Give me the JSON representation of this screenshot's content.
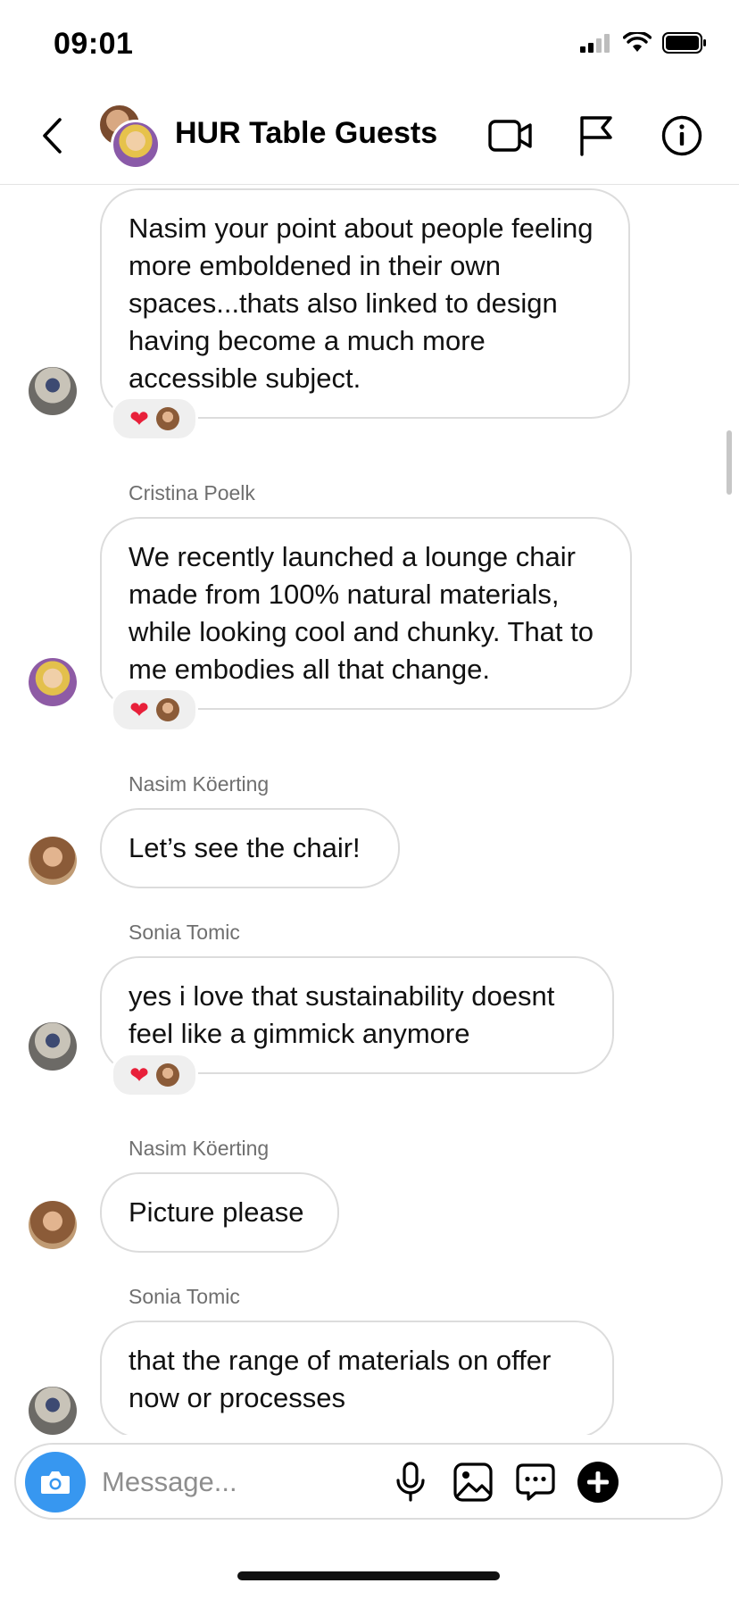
{
  "status_bar": {
    "time": "09:01"
  },
  "header": {
    "title": "HUR Table Guests"
  },
  "messages": [
    {
      "sender": "",
      "text": "Nasim your point about people feeling more emboldened in their own spaces...thats also linked to design having become a much more accessible subject.",
      "avatar": "sonia",
      "reaction": "heart"
    },
    {
      "sender": "Cristina Poelk",
      "text": "We recently launched a lounge chair made from 100% natural materials, while looking cool and chunky. That to me embodies all that change.",
      "avatar": "cristina",
      "reaction": "heart"
    },
    {
      "sender": "Nasim Köerting",
      "text": "Let’s see the chair!",
      "avatar": "nasim",
      "reaction": null
    },
    {
      "sender": "Sonia Tomic",
      "text": "yes i love that sustainability doesnt feel like a gimmick anymore",
      "avatar": "sonia",
      "reaction": "heart"
    },
    {
      "sender": "Nasim Köerting",
      "text": "Picture please",
      "avatar": "nasim",
      "reaction": null
    },
    {
      "sender": "Sonia Tomic",
      "text": "that the range of materials on offer now or processes",
      "avatar": "sonia",
      "reaction": null
    }
  ],
  "composer": {
    "placeholder": "Message..."
  },
  "icons": {
    "back": "chevron-left-icon",
    "video": "video-camera-icon",
    "report": "flag-icon",
    "info": "info-icon",
    "camera": "camera-icon",
    "mic": "microphone-icon",
    "gallery": "image-icon",
    "sticker": "chat-bubble-icon",
    "add": "plus-icon"
  },
  "colors": {
    "accent": "#3797f0",
    "heart": "#e8203a"
  }
}
